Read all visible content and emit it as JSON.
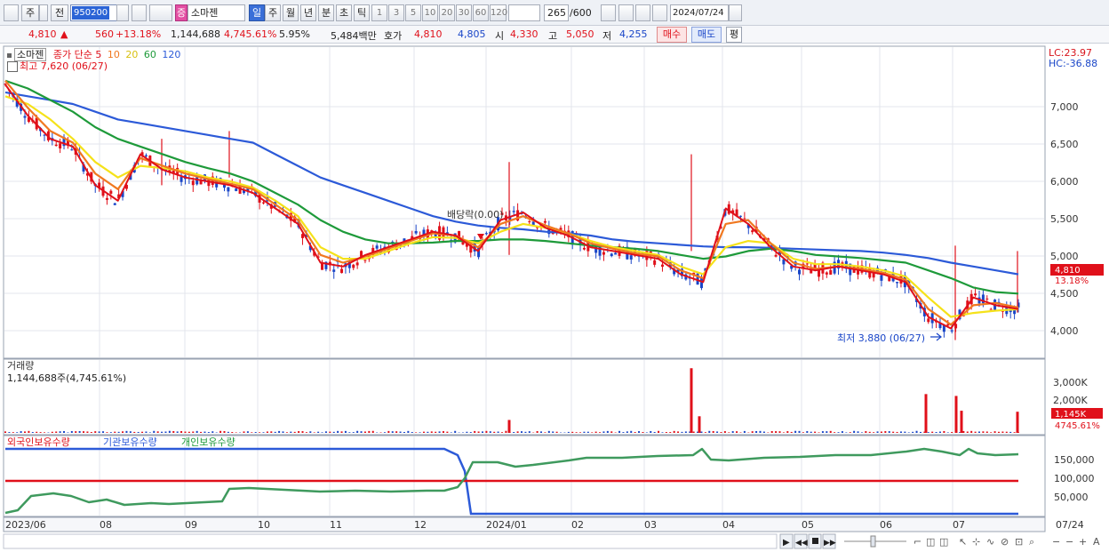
{
  "toolbar": {
    "tab_main": "주",
    "tab_prev": "전",
    "stock_code": "950200",
    "search_icon": "search-icon",
    "stock_name": "소마젠",
    "stock_badge": "증",
    "periods": [
      "일",
      "주",
      "월",
      "년",
      "분",
      "초",
      "틱"
    ],
    "active_period": "일",
    "intervals": [
      "1",
      "3",
      "5",
      "10",
      "20",
      "30",
      "60",
      "120"
    ],
    "count_value": "265",
    "count_total": "/600",
    "date_value": "2024/07/24"
  },
  "quote": {
    "price": "4,810",
    "arrow": "▲",
    "change": "560",
    "change_pct": "+13.18%",
    "volume": "1,144,688",
    "volume_pct": "4,745.61%",
    "turnover_pct": "5.95%",
    "amount": "5,484백만",
    "label_hoga": "호가",
    "ask": "4,810",
    "bid": "4,805",
    "label_open": "시",
    "open": "4,330",
    "label_high": "고",
    "high": "5,050",
    "label_low": "저",
    "low": "4,255",
    "buy_label": "매수",
    "sell_label": "매도",
    "extra_label": "평"
  },
  "price_panel": {
    "name_label": "소마젠",
    "legend_title": "종가 단순",
    "ma_periods": [
      "5",
      "10",
      "20",
      "60",
      "120"
    ],
    "ma_colors": [
      "#e0101a",
      "#f07820",
      "#f5e21a",
      "#1e9a3a",
      "#2c5ad8"
    ],
    "high_note": "최고 7,620 (06/27)",
    "low_note": "최저 3,880 (06/27)",
    "dividend_note": "배당락(0.00)",
    "lc_label": "LC:23.97",
    "hc_label": "HC:-36.88",
    "last_price_tag": "4,810",
    "last_pct_tag": "13.18%",
    "y_ticks": [
      "7,000",
      "6,500",
      "6,000",
      "5,500",
      "5,000",
      "4,500",
      "4,000"
    ]
  },
  "volume_panel": {
    "title": "거래량",
    "value": "1,144,688주(4,745.61%)",
    "y_ticks": [
      "3,000K",
      "2,000K"
    ],
    "last_tag": "1,145K",
    "last_pct": "4745.61%"
  },
  "holdings_panel": {
    "legend_foreign": "외국인보유수량",
    "legend_institution": "기관보유수량",
    "legend_individual": "개인보유수량",
    "y_ticks": [
      "150,000",
      "100,000",
      "50,000"
    ]
  },
  "x_axis": {
    "labels": [
      "2023/06",
      "08",
      "09",
      "10",
      "11",
      "12",
      "2024/01",
      "02",
      "03",
      "04",
      "05",
      "06",
      "07"
    ],
    "right_label": "07/24"
  },
  "chart_data": {
    "type": "candlestick",
    "title": "소마젠 (950200)",
    "ylim": [
      3700,
      7650
    ],
    "series": [
      {
        "name": "5",
        "values": [
          7200,
          6800,
          6500,
          6400,
          5900,
          5700,
          6300,
          6100,
          6000,
          5950,
          5900,
          5800,
          5600,
          5400,
          4900,
          4850,
          5000,
          5100,
          5200,
          5300,
          5250,
          5050,
          5450,
          5550,
          5350,
          5250,
          5100,
          5050,
          5000,
          4950,
          4750,
          4650,
          5600,
          5400,
          5100,
          4850,
          4800,
          4850,
          4800,
          4750,
          4650,
          4200,
          4050,
          4450,
          4350,
          4300
        ]
      },
      {
        "name": "10",
        "values": [
          7250,
          6900,
          6600,
          6450,
          6050,
          5850,
          6250,
          6150,
          6050,
          5980,
          5920,
          5850,
          5650,
          5450,
          5000,
          4900,
          4980,
          5080,
          5180,
          5280,
          5250,
          5100,
          5400,
          5500,
          5380,
          5280,
          5150,
          5080,
          5020,
          4980,
          4800,
          4700,
          5400,
          5450,
          5150,
          4900,
          4820,
          4850,
          4820,
          4770,
          4680,
          4300,
          4100,
          4350,
          4380,
          4320
        ]
      },
      {
        "name": "20",
        "values": [
          7050,
          6950,
          6750,
          6500,
          6200,
          6000,
          6150,
          6120,
          6080,
          6000,
          5950,
          5870,
          5700,
          5500,
          5100,
          4950,
          4950,
          5050,
          5150,
          5230,
          5220,
          5150,
          5300,
          5400,
          5350,
          5280,
          5180,
          5100,
          5050,
          5000,
          4850,
          4750,
          5100,
          5180,
          5150,
          4950,
          4880,
          4880,
          4850,
          4800,
          4720,
          4450,
          4200,
          4250,
          4280,
          4300
        ]
      },
      {
        "name": "60",
        "values": [
          7250,
          7150,
          7000,
          6850,
          6650,
          6500,
          6400,
          6300,
          6200,
          6120,
          6050,
          5950,
          5800,
          5650,
          5450,
          5300,
          5200,
          5150,
          5150,
          5160,
          5180,
          5180,
          5200,
          5200,
          5180,
          5150,
          5120,
          5100,
          5080,
          5050,
          5000,
          4950,
          4980,
          5050,
          5080,
          5050,
          5000,
          4980,
          4960,
          4930,
          4900,
          4800,
          4700,
          4580,
          4520,
          4500
        ]
      },
      {
        "name": "120",
        "values": [
          7100,
          7050,
          7000,
          6950,
          6850,
          6750,
          6700,
          6650,
          6600,
          6550,
          6500,
          6450,
          6300,
          6150,
          6000,
          5900,
          5800,
          5700,
          5600,
          5500,
          5430,
          5380,
          5350,
          5330,
          5300,
          5280,
          5250,
          5200,
          5170,
          5150,
          5130,
          5110,
          5100,
          5100,
          5090,
          5080,
          5070,
          5060,
          5050,
          5030,
          5000,
          4960,
          4900,
          4850,
          4800,
          4750
        ]
      }
    ],
    "volume_series": [
      {
        "name": "거래량",
        "spikes": [
          {
            "x": "2024/03",
            "value": 3500
          },
          {
            "x": "2024/06",
            "value": 2100
          },
          {
            "x": "2024/07",
            "value": 2000
          },
          {
            "x": "2024/07/24",
            "value": 1145
          }
        ]
      }
    ]
  }
}
